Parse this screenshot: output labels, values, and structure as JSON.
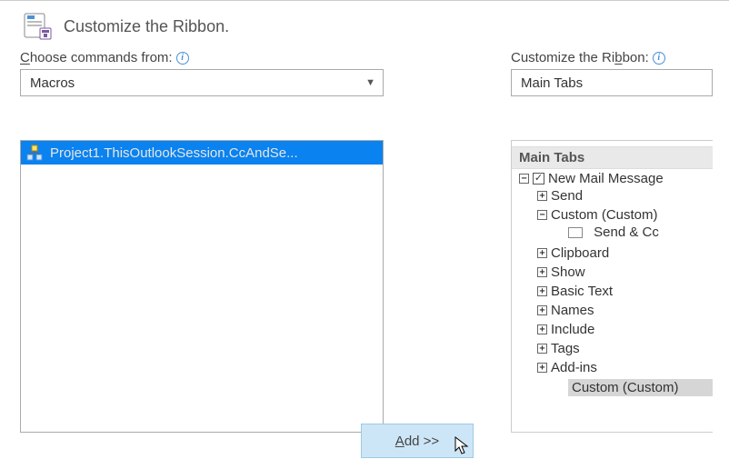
{
  "header": {
    "title": "Customize the Ribbon."
  },
  "left": {
    "label_pre": "C",
    "label_rest": "hoose commands from:",
    "combo_value": "Macros",
    "macro_item": "Project1.ThisOutlookSession.CcAndSe..."
  },
  "right": {
    "label_pre": "Customize the Ri",
    "label_u": "b",
    "label_post": "bon:",
    "combo_value": "Main Tabs",
    "tree": {
      "root": "Main Tabs",
      "level1": {
        "label": "New Mail Message",
        "children": [
          {
            "label": "Send",
            "exp": "+"
          },
          {
            "label": "Custom (Custom)",
            "exp": "-",
            "child": "Send & Cc"
          },
          {
            "label": "Clipboard",
            "exp": "+"
          },
          {
            "label": "Show",
            "exp": "+"
          },
          {
            "label": "Basic Text",
            "exp": "+"
          },
          {
            "label": "Names",
            "exp": "+"
          },
          {
            "label": "Include",
            "exp": "+"
          },
          {
            "label": "Tags",
            "exp": "+"
          },
          {
            "label": "Add-ins",
            "exp": "+"
          }
        ],
        "trailing": "Custom (Custom)"
      }
    }
  },
  "buttons": {
    "add": "Add >>"
  }
}
